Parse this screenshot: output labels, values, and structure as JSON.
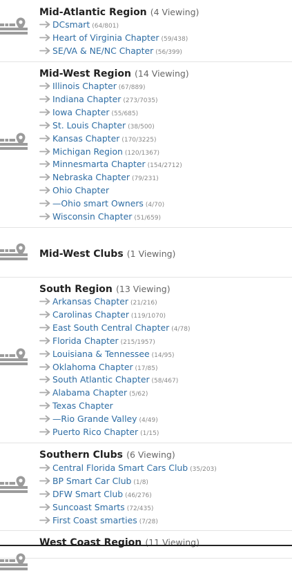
{
  "forums": [
    {
      "title": "Mid-Atlantic Region",
      "viewing": "(4 Viewing)",
      "icon": "map-pin-icon",
      "subforums": [
        {
          "name": "DCsmart",
          "stats": "(64/801)"
        },
        {
          "name": "Heart of Virginia Chapter",
          "stats": "(59/438)"
        },
        {
          "name": "SE/VA & NE/NC Chapter",
          "stats": "(56/399)"
        }
      ]
    },
    {
      "title": "Mid-West Region",
      "viewing": "(14 Viewing)",
      "icon": "map-pin-icon",
      "subforums": [
        {
          "name": "Illinois Chapter",
          "stats": "(67/889)"
        },
        {
          "name": "Indiana Chapter",
          "stats": "(273/7035)"
        },
        {
          "name": "Iowa Chapter",
          "stats": "(55/685)"
        },
        {
          "name": "St. Louis Chapter",
          "stats": "(38/500)"
        },
        {
          "name": "Kansas Chapter",
          "stats": "(170/3225)"
        },
        {
          "name": "Michigan Region",
          "stats": "(120/1367)"
        },
        {
          "name": "Minnesmarta Chapter",
          "stats": "(154/2712)"
        },
        {
          "name": "Nebraska Chapter",
          "stats": "(79/231)"
        },
        {
          "name": "Ohio Chapter",
          "stats": ""
        },
        {
          "name": "—Ohio smart Owners",
          "stats": "(4/70)"
        },
        {
          "name": "Wisconsin Chapter",
          "stats": "(51/659)"
        }
      ]
    },
    {
      "title": "Mid-West Clubs",
      "viewing": "(1 Viewing)",
      "icon": "map-pin-icon",
      "subforums": []
    },
    {
      "title": "South Region",
      "viewing": "(13 Viewing)",
      "icon": "map-pin-icon",
      "subforums": [
        {
          "name": "Arkansas Chapter",
          "stats": "(21/216)"
        },
        {
          "name": "Carolinas Chapter",
          "stats": "(119/1070)"
        },
        {
          "name": "East South Central Chapter",
          "stats": "(4/78)"
        },
        {
          "name": "Florida Chapter",
          "stats": "(215/1957)"
        },
        {
          "name": "Louisiana & Tennessee",
          "stats": "(14/95)"
        },
        {
          "name": "Oklahoma Chapter",
          "stats": "(17/85)"
        },
        {
          "name": "South Atlantic Chapter",
          "stats": "(58/467)"
        },
        {
          "name": "Alabama Chapter",
          "stats": "(5/62)"
        },
        {
          "name": "Texas Chapter",
          "stats": ""
        },
        {
          "name": "—Rio Grande Valley",
          "stats": "(4/49)"
        },
        {
          "name": "Puerto Rico Chapter",
          "stats": "(1/15)"
        }
      ]
    },
    {
      "title": "Southern Clubs",
      "viewing": "(6 Viewing)",
      "icon": "map-pin-icon",
      "subforums": [
        {
          "name": "Central Florida Smart Cars Club",
          "stats": "(35/203)"
        },
        {
          "name": "BP Smart Car Club",
          "stats": "(1/8)"
        },
        {
          "name": "DFW Smart Club",
          "stats": "(46/276)"
        },
        {
          "name": "Suncoast Smarts",
          "stats": "(72/435)"
        },
        {
          "name": "First Coast smarties",
          "stats": "(7/28)"
        }
      ]
    },
    {
      "title": "West Coast Region",
      "viewing": "(11 Viewing)",
      "icon": "map-pin-icon",
      "subforums": []
    }
  ],
  "colors": {
    "link": "#2e6da4",
    "title": "#222222",
    "muted": "#888888",
    "icon": "#9b9b9b"
  }
}
